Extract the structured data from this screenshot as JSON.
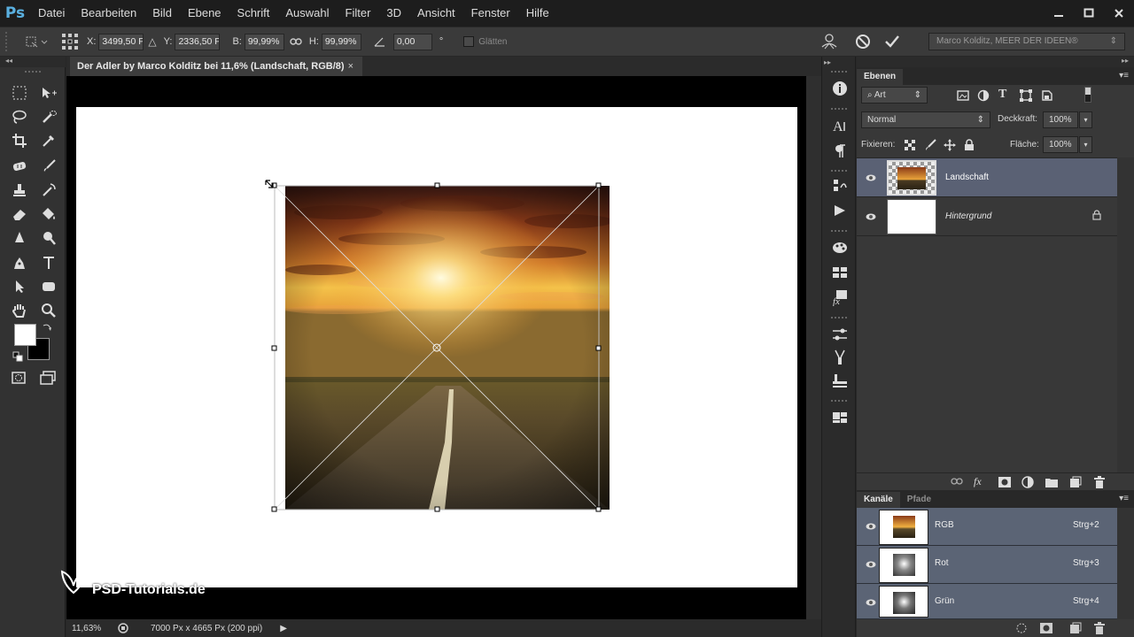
{
  "app": {
    "logo": "Ps"
  },
  "menu": [
    "Datei",
    "Bearbeiten",
    "Bild",
    "Ebene",
    "Schrift",
    "Auswahl",
    "Filter",
    "3D",
    "Ansicht",
    "Fenster",
    "Hilfe"
  ],
  "window_controls": {
    "minimize": "minimize-icon",
    "maximize": "maximize-icon",
    "close": "close-icon"
  },
  "options": {
    "x_label": "X:",
    "x_value": "3499,50 P.",
    "y_label": "Y:",
    "y_value": "2336,50 P.",
    "w_label": "B:",
    "w_value": "99,99%",
    "h_label": "H:",
    "h_value": "99,99%",
    "angle_value": "0,00",
    "angle_unit": "°",
    "smooth_label": "Glätten",
    "workspace": "Marco Kolditz, MEER DER IDEEN®"
  },
  "document": {
    "tab_title": "Der Adler by Marco Kolditz bei 11,6% (Landschaft, RGB/8)",
    "tab_close": "×",
    "zoom": "11,63%",
    "doc_info": "7000 Px x 4665 Px (200 ppi)",
    "watermark": "PSD-Tutorials.de"
  },
  "layers_panel": {
    "tab": "Ebenen",
    "filter_kind": "Art",
    "blend_mode": "Normal",
    "opacity_label": "Deckkraft:",
    "opacity": "100%",
    "lock_label": "Fixieren:",
    "fill_label": "Fläche:",
    "fill": "100%",
    "layers": [
      {
        "name": "Landschaft",
        "selected": true
      },
      {
        "name": "Hintergrund",
        "selected": false,
        "locked": true
      }
    ]
  },
  "channels_panel": {
    "tabs": [
      "Kanäle",
      "Pfade"
    ],
    "channels": [
      {
        "name": "RGB",
        "shortcut": "Strg+2"
      },
      {
        "name": "Rot",
        "shortcut": "Strg+3"
      },
      {
        "name": "Grün",
        "shortcut": "Strg+4"
      }
    ]
  },
  "colors": {
    "accent": "#5ab0e0",
    "selected_layer": "#5a6174",
    "ui_bg": "#383838"
  }
}
